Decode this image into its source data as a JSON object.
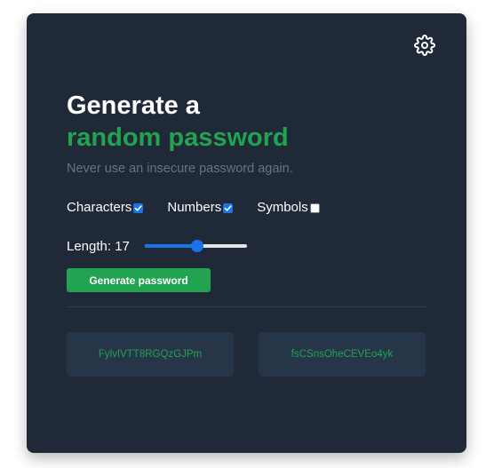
{
  "header": {
    "title_line1": "Generate a",
    "title_line2": "random password",
    "subtitle": "Never use an insecure password again.",
    "settings_icon": "gear-icon"
  },
  "options": [
    {
      "label": "Characters",
      "checked": true
    },
    {
      "label": "Numbers",
      "checked": true
    },
    {
      "label": "Symbols",
      "checked": false
    }
  ],
  "length": {
    "label": "Length:",
    "value": 17,
    "min": 1,
    "max": 32
  },
  "generate_button": {
    "label": "Generate password"
  },
  "passwords": [
    "FylvIVTT8RGQzGJPm",
    "fsCSnsOheCEVEo4yk"
  ],
  "colors": {
    "card_bg": "#1f2937",
    "accent_green": "#22a352",
    "muted_text": "#6b7280",
    "checkbox_blue": "#1a73e8",
    "password_box_bg": "#273548"
  }
}
